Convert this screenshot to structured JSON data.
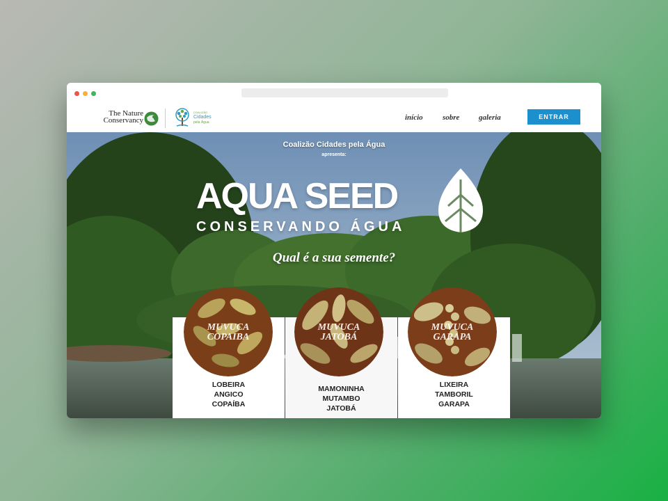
{
  "navbar": {
    "logo_tnc_line1": "The Nature",
    "logo_tnc_line2": "Conservancy",
    "logo_coalition_small": "COALIZÃO",
    "logo_coalition_line1": "Cidades",
    "logo_coalition_line2": "pela Água",
    "links": [
      "início",
      "sobre",
      "galeria"
    ],
    "cta_label": "ENTRAR"
  },
  "hero": {
    "presenter": "Coalizão Cidades pela Água",
    "presents": "apresenta:",
    "title": "AQUA SEED",
    "subtitle": "CONSERVANDO ÁGUA",
    "question": "Qual é a sua semente?"
  },
  "cards": [
    {
      "label_line1": "MUVUCA",
      "label_line2": "COPAIBA",
      "names": [
        "LOBEIRA",
        "ANGICO",
        "COPAÍBA"
      ]
    },
    {
      "label_line1": "MUVUCA",
      "label_line2": "JATOBÁ",
      "names": [
        "MAMONINHA",
        "MUTAMBO",
        "JATOBÁ"
      ]
    },
    {
      "label_line1": "MUVUCA",
      "label_line2": "GARAPA",
      "names": [
        "LIXEIRA",
        "TAMBORIL",
        "GARAPA"
      ]
    }
  ],
  "colors": {
    "cta": "#1c8fcd",
    "circle_tint": "#8a4a1e",
    "foliage": "#2f5a22"
  }
}
